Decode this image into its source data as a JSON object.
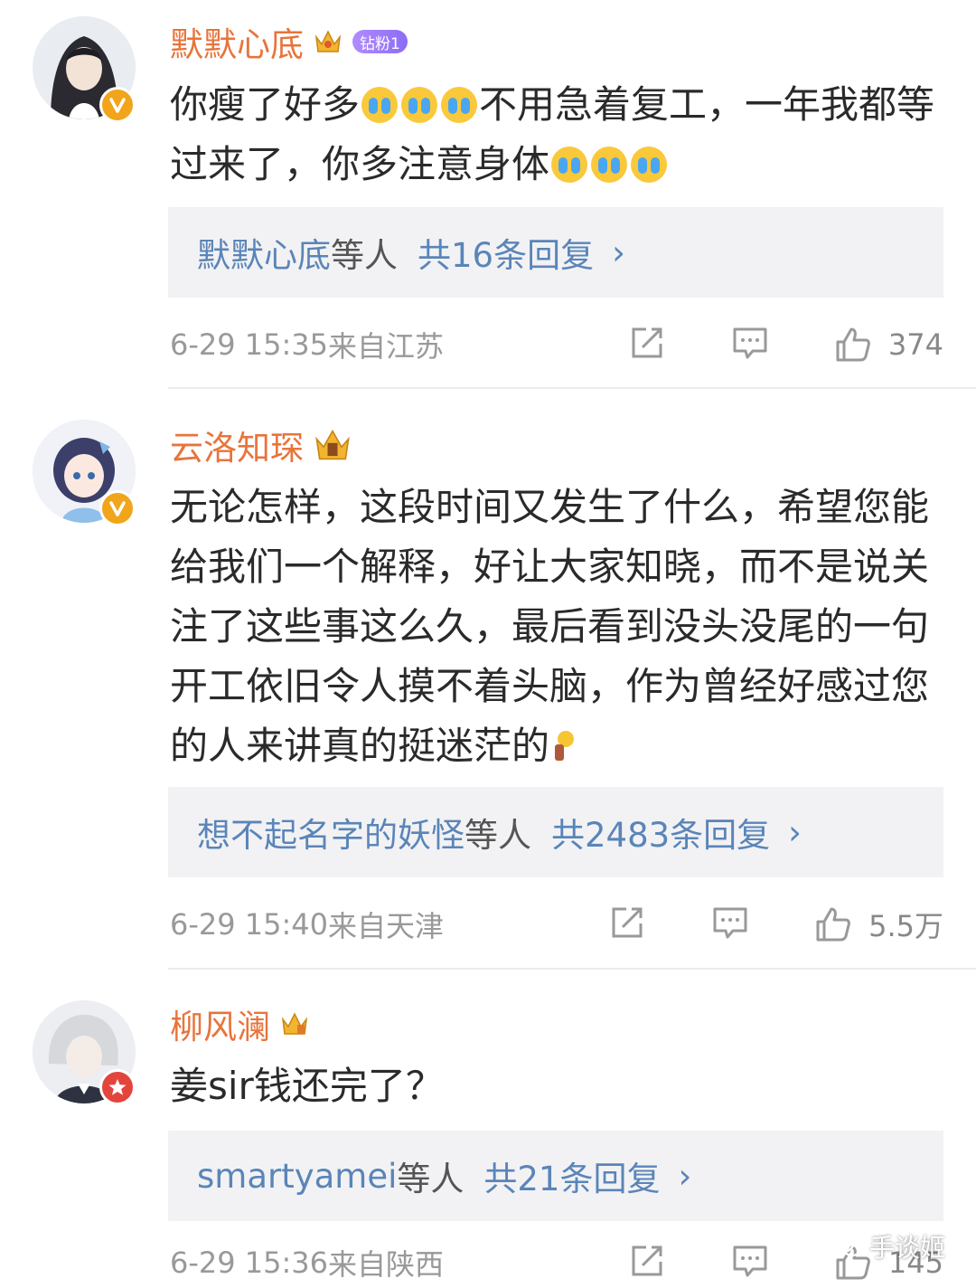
{
  "comments": [
    {
      "name": "默默心底",
      "vip_tag": "钻粉1",
      "badge": "v-badge",
      "text": "你瘦了好多",
      "text_mid": "不用急着复工，一年我都等过来了，你多注意身体",
      "replies": {
        "who": "默默心底",
        "mid": "等人",
        "count": "共16条回复",
        "chev": "›"
      },
      "time": "6-29 15:35",
      "location": "来自江苏",
      "likes": "374"
    },
    {
      "name": "云洛知琛",
      "badge": "v-badge",
      "text": "无论怎样，这段时间又发生了什么，希望您能给我们一个解释，好让大家知晓，而不是说关注了这些事这么久，最后看到没头没尾的一句开工依旧令人摸不着头脑，作为曾经好感过您的人来讲真的挺迷茫的",
      "replies": {
        "who": "想不起名字的妖怪",
        "mid": "等人",
        "count": "共2483条回复",
        "chev": "›"
      },
      "time": "6-29 15:40",
      "location": "来自天津",
      "likes": "5.5万"
    },
    {
      "name": "柳风澜",
      "badge": "star-badge",
      "text": "姜sir钱还完了？",
      "replies": {
        "who": "smartyamei",
        "mid": "等人",
        "count": "共21条回复",
        "chev": "›"
      },
      "time": "6-29 15:36",
      "location": "来自陕西",
      "likes": "145"
    }
  ],
  "watermark": "手谈姬",
  "icons": [
    "share-icon",
    "comment-icon",
    "like-icon",
    "crown-icon",
    "v-badge-icon",
    "star-badge-icon",
    "crying-emoji-icon",
    "bulb-emoji-icon",
    "wechat-icon"
  ],
  "colors": {
    "name": "#e8743b",
    "link": "#5a85b8",
    "meta": "#999999",
    "reply_bg": "#f2f2f4"
  }
}
